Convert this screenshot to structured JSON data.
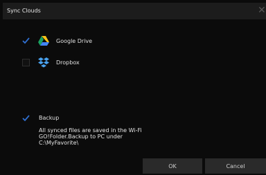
{
  "dialog": {
    "title": "Sync Clouds",
    "close_glyph": "✕"
  },
  "services": [
    {
      "name": "Google Drive",
      "checked": true,
      "icon": "google-drive-icon"
    },
    {
      "name": "Dropbox",
      "checked": false,
      "icon": "dropbox-icon"
    }
  ],
  "backup": {
    "label": "Backup",
    "checked": true,
    "description_lines": [
      "All synced files are saved in the Wi-Fi",
      "GO!Folder.Backup to PC under",
      "C:\\MyFavorite\\"
    ]
  },
  "buttons": {
    "ok": "OK",
    "cancel": "Cancel"
  },
  "colors": {
    "background": "#0b0b0b",
    "titlebar": "#1c1c1c",
    "check": "#2f6fd0",
    "button": "#2a2a2a"
  }
}
